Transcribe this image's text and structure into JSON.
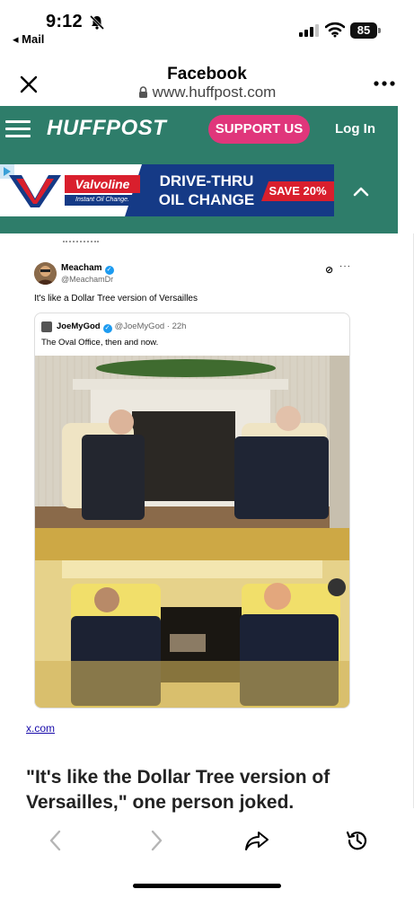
{
  "status_bar": {
    "time": "9:12",
    "back_app": "◂ Mail",
    "battery": "85"
  },
  "browser": {
    "title": "Facebook",
    "url": "www.huffpost.com"
  },
  "huffpost_nav": {
    "logo": "HUFFPOST",
    "support_label": "SUPPORT US",
    "login_label": "Log In",
    "brand_color": "#2e7d6a",
    "support_color": "#e0367b"
  },
  "ad": {
    "brand": "Valvoline",
    "brand_tagline": "Instant Oil Change.",
    "headline_line1": "DRIVE-THRU",
    "headline_line2": "OIL CHANGE",
    "offer": "SAVE 20%"
  },
  "tweet": {
    "author_name": "Meacham",
    "author_handle": "@MeachamDr",
    "text": "It's like a Dollar Tree version of Versailles",
    "quoted": {
      "author_name": "JoeMyGod",
      "author_handle": "@JoeMyGod · 22h",
      "text": "The Oval Office, then and now."
    }
  },
  "article": {
    "source_link": "x.com",
    "pull_quote": "\"It's like the Dollar Tree version of Versailles,\" one person joked."
  },
  "toolbar": {
    "icons": [
      "back-icon",
      "forward-icon",
      "share-icon",
      "history-icon"
    ]
  }
}
